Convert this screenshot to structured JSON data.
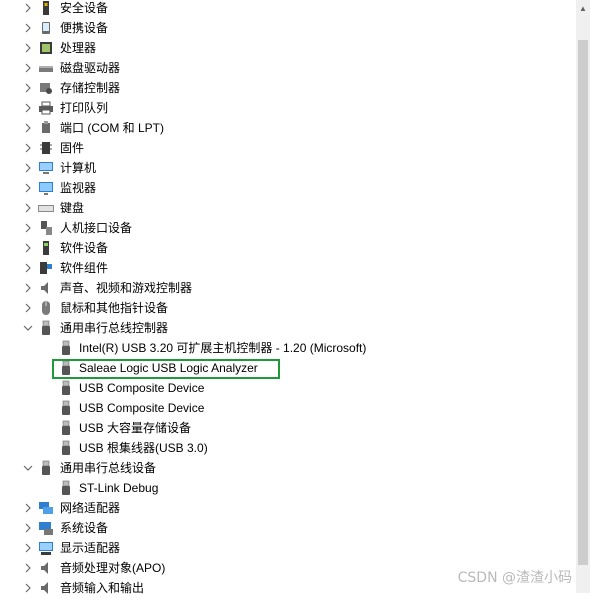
{
  "tree": {
    "items": [
      {
        "label": "安全设备",
        "icon": "security-device-icon",
        "expanded": false
      },
      {
        "label": "便携设备",
        "icon": "portable-device-icon",
        "expanded": false
      },
      {
        "label": "处理器",
        "icon": "processor-icon",
        "expanded": false
      },
      {
        "label": "磁盘驱动器",
        "icon": "disk-drive-icon",
        "expanded": false
      },
      {
        "label": "存储控制器",
        "icon": "storage-controller-icon",
        "expanded": false
      },
      {
        "label": "打印队列",
        "icon": "printer-icon",
        "expanded": false
      },
      {
        "label": "端口 (COM 和 LPT)",
        "icon": "port-icon",
        "expanded": false
      },
      {
        "label": "固件",
        "icon": "firmware-icon",
        "expanded": false
      },
      {
        "label": "计算机",
        "icon": "computer-icon",
        "expanded": false
      },
      {
        "label": "监视器",
        "icon": "monitor-icon",
        "expanded": false
      },
      {
        "label": "键盘",
        "icon": "keyboard-icon",
        "expanded": false
      },
      {
        "label": "人机接口设备",
        "icon": "hid-icon",
        "expanded": false
      },
      {
        "label": "软件设备",
        "icon": "software-device-icon",
        "expanded": false
      },
      {
        "label": "软件组件",
        "icon": "software-component-icon",
        "expanded": false
      },
      {
        "label": "声音、视频和游戏控制器",
        "icon": "speaker-icon",
        "expanded": false
      },
      {
        "label": "鼠标和其他指针设备",
        "icon": "mouse-icon",
        "expanded": false
      },
      {
        "label": "通用串行总线控制器",
        "icon": "usb-icon",
        "expanded": true
      },
      {
        "label": "Intel(R) USB 3.20 可扩展主机控制器 - 1.20 (Microsoft)",
        "icon": "usb-icon",
        "child": true
      },
      {
        "label": "Saleae Logic USB Logic Analyzer",
        "icon": "usb-icon",
        "child": true,
        "highlighted": true
      },
      {
        "label": "USB Composite Device",
        "icon": "usb-icon",
        "child": true
      },
      {
        "label": "USB Composite Device",
        "icon": "usb-icon",
        "child": true
      },
      {
        "label": "USB 大容量存储设备",
        "icon": "usb-icon",
        "child": true
      },
      {
        "label": "USB 根集线器(USB 3.0)",
        "icon": "usb-icon",
        "child": true
      },
      {
        "label": "通用串行总线设备",
        "icon": "usb-icon",
        "expanded": true
      },
      {
        "label": "ST-Link Debug",
        "icon": "usb-icon",
        "child": true
      },
      {
        "label": "网络适配器",
        "icon": "network-adapter-icon",
        "expanded": false
      },
      {
        "label": "系统设备",
        "icon": "system-device-icon",
        "expanded": false
      },
      {
        "label": "显示适配器",
        "icon": "display-adapter-icon",
        "expanded": false
      },
      {
        "label": "音频处理对象(APO)",
        "icon": "audio-apo-icon",
        "expanded": false
      },
      {
        "label": "音频输入和输出",
        "icon": "audio-io-icon",
        "expanded": false
      }
    ]
  },
  "colors": {
    "highlight_outline": "#1e9a3a",
    "chevron": "#6a6a6a"
  },
  "watermark": "CSDN @渣渣小码"
}
